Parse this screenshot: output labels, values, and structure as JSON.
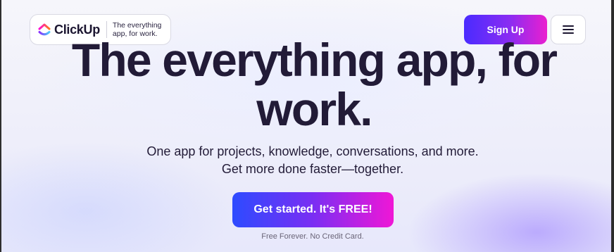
{
  "header": {
    "logo": {
      "icon": "clickup-logo-icon",
      "wordmark": "ClickUp",
      "tagline_line1": "The everything",
      "tagline_line2": "app, for work."
    },
    "signup_label": "Sign Up",
    "menu_icon": "hamburger-menu-icon"
  },
  "hero": {
    "headline_line1": "The everything app, for",
    "headline_line2": "work.",
    "subtitle_line1": "One app for projects, knowledge, conversations, and more.",
    "subtitle_line2": "Get more done faster—together.",
    "cta_label": "Get started. It's FREE!",
    "fine_print": "Free Forever. No Credit Card."
  },
  "colors": {
    "heading": "#221b37",
    "cta_start": "#2d4bff",
    "cta_end": "#f017d6"
  }
}
